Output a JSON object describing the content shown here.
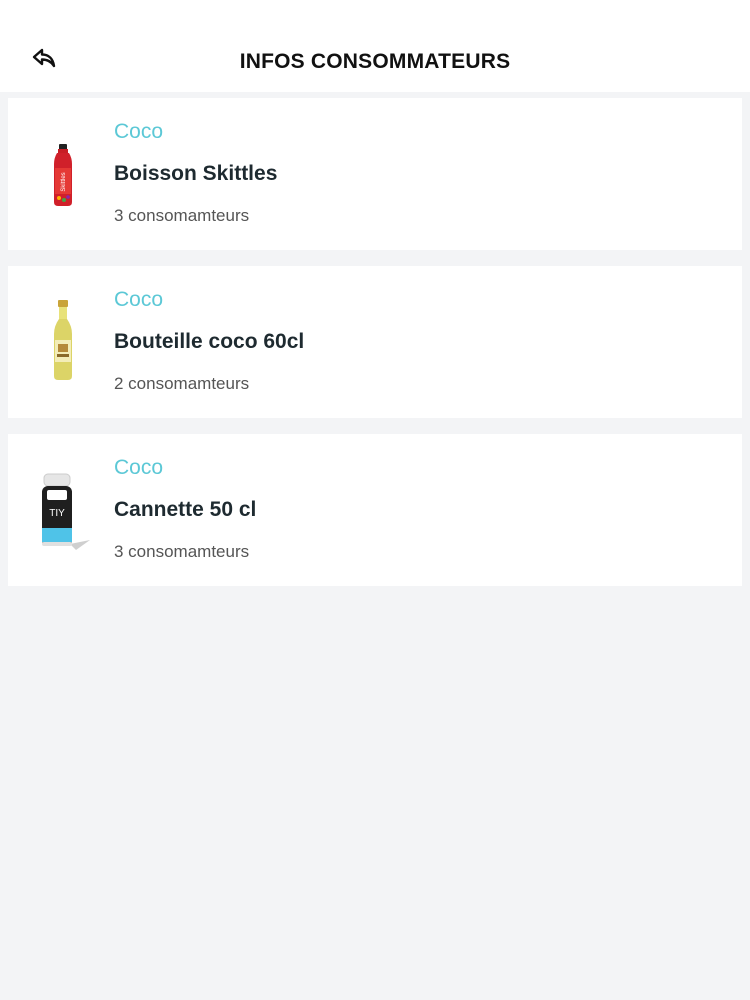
{
  "header": {
    "title": "INFOS CONSOMMATEURS",
    "back_icon": "back-arrow-icon"
  },
  "products": [
    {
      "brand": "Coco",
      "name": "Boisson Skittles",
      "consumers": "3 consomamteurs",
      "image": "skittles-bottle-image"
    },
    {
      "brand": "Coco",
      "name": "Bouteille coco 60cl",
      "consumers": "2 consomamteurs",
      "image": "coco-bottle-image"
    },
    {
      "brand": "Coco",
      "name": "Cannette 50 cl",
      "consumers": "3 consomamteurs",
      "image": "can-drink-image"
    }
  ],
  "colors": {
    "background": "#f3f4f6",
    "card": "#ffffff",
    "brand": "#5cc8d6",
    "title": "#111111",
    "product_name": "#1e2a30",
    "count": "#555555"
  }
}
